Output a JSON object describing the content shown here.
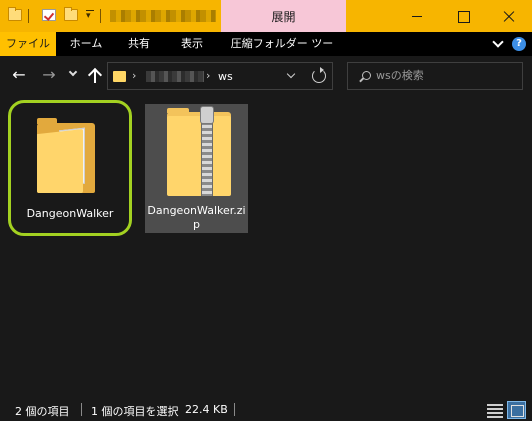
{
  "titlebar": {
    "context_tab": "展開"
  },
  "ribbon": {
    "tabs": [
      "ファイル",
      "ホーム",
      "共有",
      "表示",
      "圧縮フォルダー ツール"
    ],
    "help_label": "?"
  },
  "navbar": {
    "back_glyph": "←",
    "forward_glyph": "→",
    "crumb_separator": "›",
    "current_folder": "ws",
    "search_placeholder": "wsの検索"
  },
  "items": [
    {
      "name": "DangeonWalker",
      "type": "folder"
    },
    {
      "name": "DangeonWalker.zip",
      "type": "zip-folder"
    }
  ],
  "status": {
    "item_count": "2 個の項目",
    "selection": "1 個の項目を選択",
    "size": "22.4 KB"
  },
  "colors": {
    "titlebar": "#f7b500",
    "context_tab": "#f7c7d7",
    "file_tab": "#ffc000",
    "highlight_ring": "#a3d121",
    "selection": "#4d4d4d",
    "background": "#191919"
  }
}
